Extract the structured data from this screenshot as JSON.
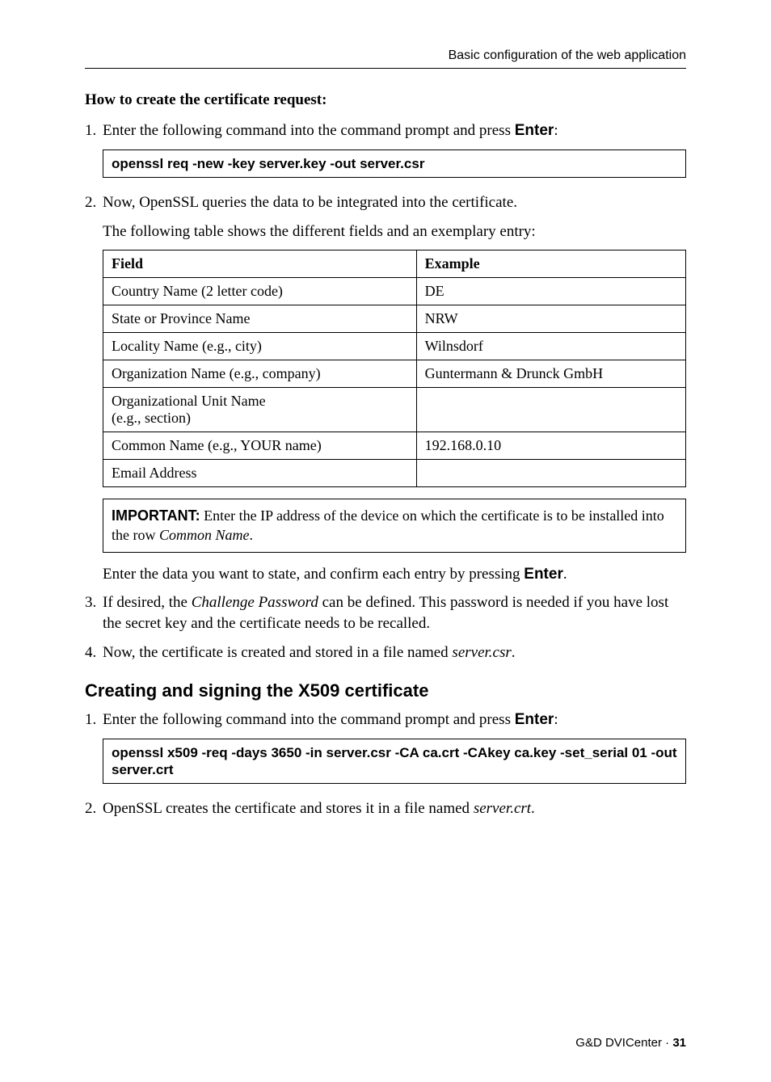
{
  "running_head": "Basic configuration of the web application",
  "create_request": {
    "heading": "How to create the certificate request:",
    "step1": {
      "num": "1.",
      "text_prefix": "Enter the following command into the command prompt and press ",
      "key": "Enter",
      "text_suffix": ":"
    },
    "code1": "openssl req -new -key server.key -out server.csr",
    "step2": {
      "num": "2.",
      "text": "Now, OpenSSL queries the data to be integrated into the certificate."
    },
    "step2b": "The following table shows the different fields and an exemplary entry:",
    "table": {
      "head_field": "Field",
      "head_example": "Example",
      "rows": [
        {
          "field": "Country Name (2 letter code)",
          "example": "DE"
        },
        {
          "field": "State or Province Name",
          "example": "NRW"
        },
        {
          "field": "Locality Name (e.g., city)",
          "example": "Wilnsdorf"
        },
        {
          "field": "Organization Name (e.g., company)",
          "example": "Guntermann & Drunck GmbH"
        },
        {
          "field": "Organizational Unit Name\n(e.g., section)",
          "example": ""
        },
        {
          "field": "Common Name (e.g., YOUR name)",
          "example": "192.168.0.10"
        },
        {
          "field": "Email Address",
          "example": ""
        }
      ]
    },
    "important": {
      "label": "IMPORTANT:",
      "text_prefix": " Enter the IP address of the device on which the certificate is to be installed into the row ",
      "italic": "Common Name",
      "text_suffix": "."
    },
    "post_important": {
      "text_prefix": "Enter the data you want to state, and confirm each entry by pressing ",
      "key": "Enter",
      "text_suffix": "."
    },
    "step3": {
      "num": "3.",
      "text_prefix": "If desired, the ",
      "italic": "Challenge Password",
      "text_suffix": " can be defined. This password is needed if you have lost the secret key and the certificate needs to be recalled."
    },
    "step4": {
      "num": "4.",
      "text_prefix": "Now, the certificate is created and stored in a file named ",
      "italic": "server.csr",
      "text_suffix": "."
    }
  },
  "x509": {
    "heading": "Creating and signing the X509 certificate",
    "step1": {
      "num": "1.",
      "text_prefix": "Enter the following command into the command prompt and press ",
      "key": "Enter",
      "text_suffix": ":"
    },
    "code1": "openssl x509 -req -days 3650 -in server.csr -CA ca.crt -CAkey ca.key -set_serial 01 -out server.crt",
    "step2": {
      "num": "2.",
      "text_prefix": "OpenSSL creates the certificate and stores it in a file named ",
      "italic": "server.crt",
      "text_suffix": "."
    }
  },
  "footer": {
    "product": "G&D DVICenter · ",
    "page": "31"
  }
}
